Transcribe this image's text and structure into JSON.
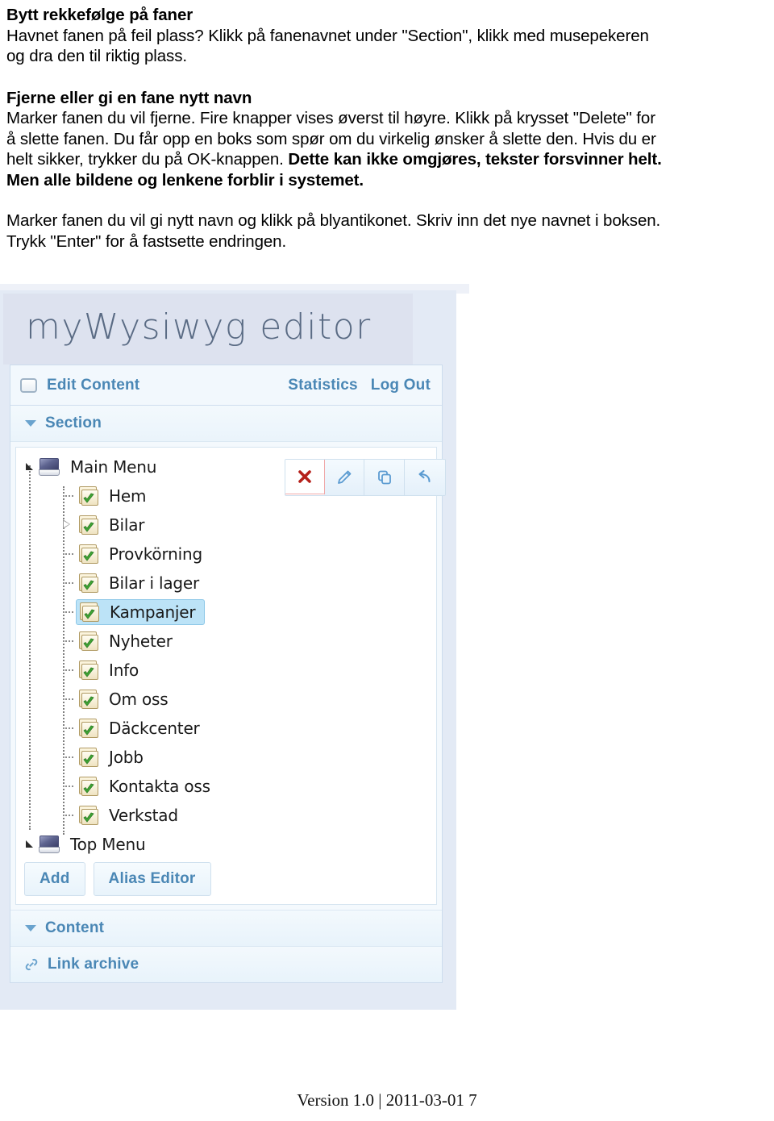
{
  "document": {
    "sections": [
      {
        "heading": "Bytt rekkefølge på faner",
        "lines": [
          "Havnet fanen på feil plass? Klikk på fanenavnet under \"Section\", klikk med musepekeren",
          "og dra den til riktig plass."
        ]
      },
      {
        "heading": "Fjerne eller gi en fane nytt navn",
        "lines": [
          "Marker fanen du vil fjerne. Fire knapper vises øverst til høyre. Klikk på krysset \"Delete\" for",
          "å slette fanen. Du får opp en boks som spør om du virkelig ønsker å slette den. Hvis du er",
          "helt sikker, trykker du på OK-knappen."
        ],
        "bold_run_1": "Dette kan ikke omgjøres, tekster forsvinner helt.",
        "bold_run_2": "Men alle bildene og lenkene forblir i systemet."
      },
      {
        "heading": "",
        "lines": [
          "Marker fanen du vil gi nytt navn og klikk på blyantikonet. Skriv inn det nye navnet i boksen.",
          "Trykk \"Enter\" for å fastsette endringen."
        ]
      }
    ]
  },
  "app": {
    "brand": "myWysiwyg editor",
    "nav": {
      "edit_content": "Edit Content",
      "statistics": "Statistics",
      "log_out": "Log Out",
      "edit_content_icon": "window-icon"
    },
    "section_panel": {
      "title": "Section",
      "toggle_icon": "chevron-down-icon",
      "tree": [
        {
          "label": "Main Menu",
          "level": 0,
          "icon": "drive-icon",
          "marker": "expanded",
          "selected": false
        },
        {
          "label": "Hem",
          "level": 1,
          "icon": "folder-published-icon",
          "marker": "leaf",
          "selected": false
        },
        {
          "label": "Bilar",
          "level": 1,
          "icon": "folder-published-icon",
          "marker": "collapsed",
          "selected": false
        },
        {
          "label": "Provkörning",
          "level": 1,
          "icon": "folder-published-icon",
          "marker": "leaf",
          "selected": false
        },
        {
          "label": "Bilar i lager",
          "level": 1,
          "icon": "folder-published-icon",
          "marker": "leaf",
          "selected": false
        },
        {
          "label": "Kampanjer",
          "level": 1,
          "icon": "folder-published-icon",
          "marker": "leaf",
          "selected": true
        },
        {
          "label": "Nyheter",
          "level": 1,
          "icon": "folder-published-icon",
          "marker": "leaf",
          "selected": false
        },
        {
          "label": "Info",
          "level": 1,
          "icon": "folder-published-icon",
          "marker": "leaf",
          "selected": false
        },
        {
          "label": "Om oss",
          "level": 1,
          "icon": "folder-published-icon",
          "marker": "leaf",
          "selected": false
        },
        {
          "label": "Däckcenter",
          "level": 1,
          "icon": "folder-published-icon",
          "marker": "leaf",
          "selected": false
        },
        {
          "label": "Jobb",
          "level": 1,
          "icon": "folder-published-icon",
          "marker": "leaf",
          "selected": false
        },
        {
          "label": "Kontakta oss",
          "level": 1,
          "icon": "folder-published-icon",
          "marker": "leaf",
          "selected": false
        },
        {
          "label": "Verkstad",
          "level": 1,
          "icon": "folder-published-icon",
          "marker": "leaf",
          "selected": false
        },
        {
          "label": "Top Menu",
          "level": 0,
          "icon": "drive-icon",
          "marker": "expanded",
          "selected": false
        }
      ],
      "actions": [
        {
          "name": "delete",
          "icon": "cross-icon",
          "color": "#c0392b"
        },
        {
          "name": "edit",
          "icon": "pencil-icon",
          "color": "#5b9bd1"
        },
        {
          "name": "copy",
          "icon": "copy-icon",
          "color": "#5b9bd1"
        },
        {
          "name": "undo",
          "icon": "undo-arrow-icon",
          "color": "#5b9bd1"
        }
      ],
      "buttons": {
        "add": "Add",
        "alias_editor": "Alias Editor"
      }
    },
    "content_panel": {
      "title": "Content",
      "toggle_icon": "chevron-down-icon"
    },
    "link_archive_panel": {
      "title": "Link archive",
      "icon": "chain-link-icon"
    },
    "colors": {
      "brand_bg": "#dde2ef",
      "accent_text": "#4a87b5",
      "selection_bg": "#bce3f7",
      "delete_border": "#f0a8a8"
    }
  },
  "footer": {
    "text": "Version 1.0 | 2011-03-01 7"
  }
}
